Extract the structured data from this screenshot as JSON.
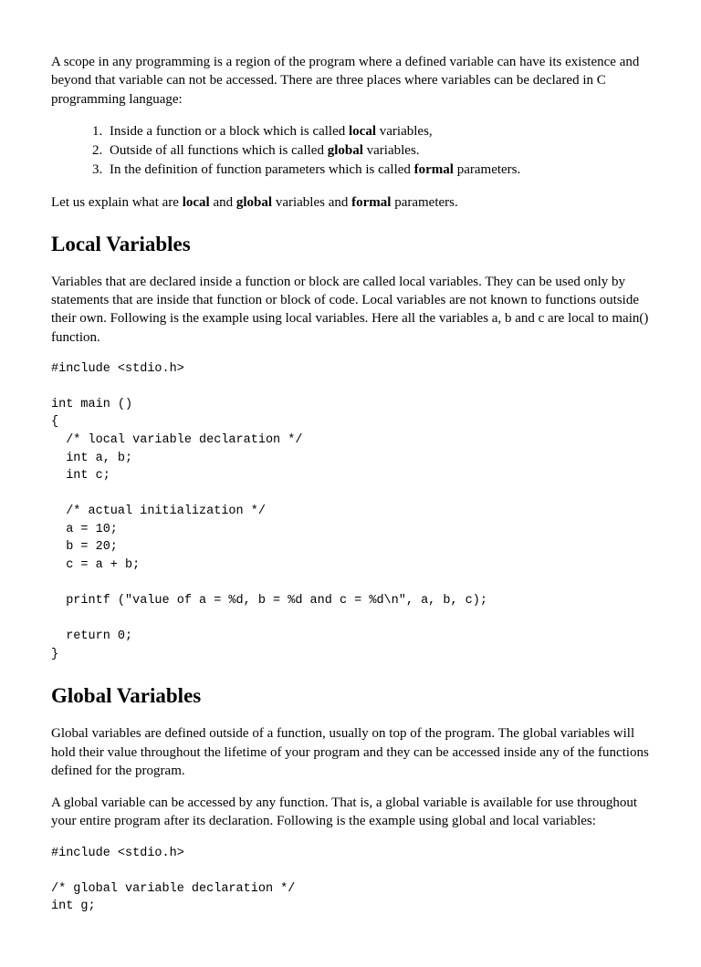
{
  "intro_p1_a": "A scope in any programming is a region of the program where a defined variable can have its existence and beyond that variable can not be accessed. There are three places where variables can be declared in C programming language:",
  "list": {
    "i1_a": "Inside a function or a block which is called ",
    "i1_b": "local",
    "i1_c": " variables,",
    "i2_a": "Outside of all functions which is called ",
    "i2_b": "global",
    "i2_c": " variables.",
    "i3_a": "In the definition of function parameters which is called ",
    "i3_b": "formal",
    "i3_c": " parameters."
  },
  "intro_p2_a": "Let us explain what are ",
  "intro_p2_b": "local",
  "intro_p2_c": " and ",
  "intro_p2_d": "global",
  "intro_p2_e": " variables and ",
  "intro_p2_f": "formal",
  "intro_p2_g": " parameters.",
  "h_local": "Local Variables",
  "local_p1": "Variables that are declared inside a function or block are called local variables. They can be used only by statements that are inside that function or block of code. Local variables are not known to functions outside their own. Following is the example using local variables. Here all the variables a, b and c are local to main() function.",
  "code_local": "#include <stdio.h>\n\nint main ()\n{\n  /* local variable declaration */\n  int a, b;\n  int c;\n\n  /* actual initialization */\n  a = 10;\n  b = 20;\n  c = a + b;\n\n  printf (\"value of a = %d, b = %d and c = %d\\n\", a, b, c);\n\n  return 0;\n}",
  "h_global": "Global Variables",
  "global_p1": "Global variables are defined outside of a function, usually on top of the program. The global variables will hold their value throughout the lifetime of your program and they can be accessed inside any of the functions defined for the program.",
  "global_p2": "A global variable can be accessed by any function. That is, a global variable is available for use throughout your entire program after its declaration. Following is the example using global and local variables:",
  "code_global": "#include <stdio.h>\n\n/* global variable declaration */\nint g;"
}
